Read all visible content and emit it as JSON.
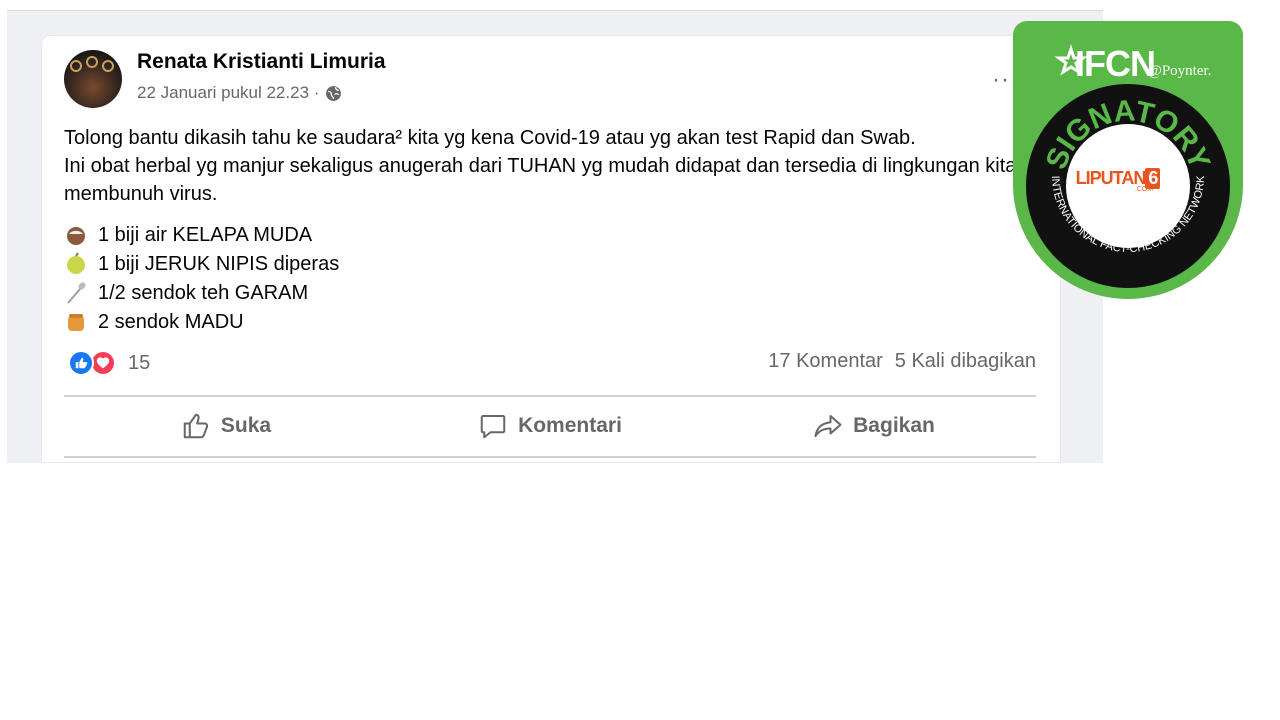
{
  "post": {
    "author": "Renata Kristianti Limuria",
    "timestamp": "22 Januari pukul 22.23 ·",
    "privacy_icon": "globe-icon",
    "more_label": "···",
    "paragraph_1": "Tolong bantu dikasih tahu ke saudara² kita yg kena Covid-19 atau yg akan test Rapid dan Swab.",
    "paragraph_2": "Ini obat herbal yg manjur sekaligus anugerah dari TUHAN yg mudah didapat dan tersedia di lingkungan kita utk membunuh virus.",
    "ingredients": [
      {
        "icon": "coconut-icon",
        "text": "1 biji air KELAPA MUDA"
      },
      {
        "icon": "lime-icon",
        "text": "1 biji JERUK NIPIS diperas"
      },
      {
        "icon": "spoon-icon",
        "text": "1/2 sendok teh GARAM"
      },
      {
        "icon": "honey-icon",
        "text": "2 sendok MADU"
      }
    ],
    "reactions_count": "15",
    "comments": "17 Komentar",
    "shares": "5 Kali dibagikan",
    "actions": {
      "like": "Suka",
      "comment": "Komentari",
      "share": "Bagikan"
    }
  },
  "badge": {
    "brand": "IFCN",
    "partner": "@Poynter.",
    "signatory": "SIGNATORY",
    "network": "INTERNATIONAL FACT-CHECKING NETWORK",
    "member_name": "LIPUTAN",
    "member_number": "6",
    "member_suffix": ".COM",
    "colors": {
      "green": "#59b847",
      "ring": "#111111",
      "orange": "#e8541f"
    }
  },
  "colors": {
    "text": "#050505",
    "secondary": "#65676b",
    "like_blue": "#1877f2",
    "love_red": "#f33e58"
  }
}
